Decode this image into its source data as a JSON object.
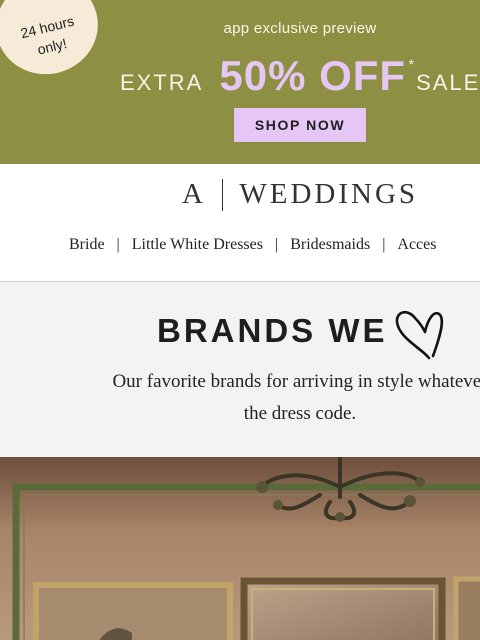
{
  "promo": {
    "badge_line1": "24 hours",
    "badge_line2": "only!",
    "kicker": "app exclusive preview",
    "extra": "EXTRA",
    "percent": "50% OFF",
    "asterisk": "*",
    "sale": "SALE",
    "button": "SHOP NOW",
    "colors": {
      "background": "#8d8f42",
      "accent": "#e6c6f4",
      "badge": "#f6ebd9"
    }
  },
  "header": {
    "logo_letter": "A",
    "logo_word": "WEDDINGS",
    "nav": [
      "Bride",
      "Little White Dresses",
      "Bridesmaids",
      "Acces"
    ],
    "separator": "|"
  },
  "brands": {
    "title": "BRANDS WE",
    "heart_icon": "heart-icon",
    "description": "Our favorite brands for arriving in style whatever the dress code."
  },
  "photo": {
    "alt": "interior-with-chandelier-and-framed-pictures"
  }
}
